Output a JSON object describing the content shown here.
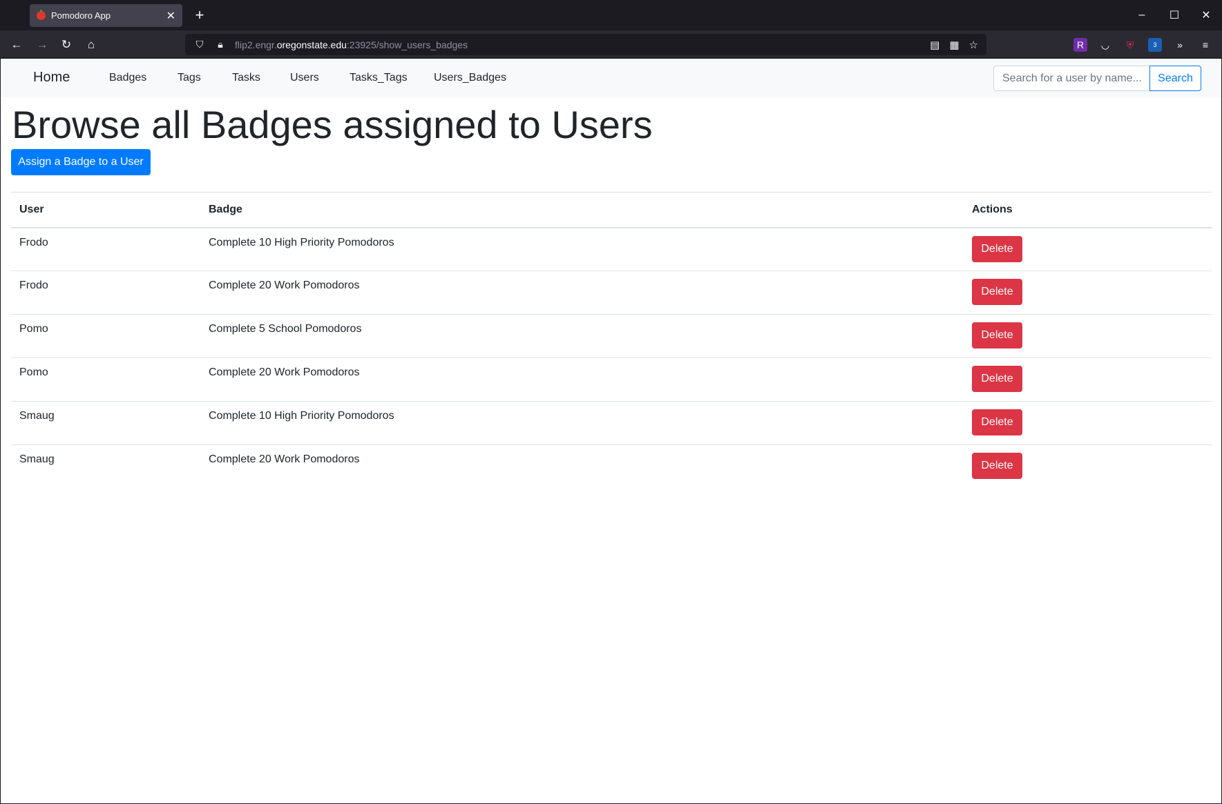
{
  "browser": {
    "tab_title": "Pomodoro App",
    "url_prefix": "flip2.engr.",
    "url_domain": "oregonstate.edu",
    "url_suffix": ":23925/show_users_badges",
    "extension_badge_count": "3"
  },
  "site": {
    "brand": "Home",
    "nav_links": [
      "Badges",
      "Tags",
      "Tasks",
      "Users",
      "Tasks_Tags",
      "Users_Badges"
    ],
    "search_placeholder": "Search for a user by name...",
    "search_label": "Search"
  },
  "page": {
    "title": "Browse all Badges assigned to Users",
    "assign_button": "Assign a Badge to a User"
  },
  "table": {
    "headers": [
      "User",
      "Badge",
      "Actions"
    ],
    "delete_label": "Delete",
    "rows": [
      {
        "user": "Frodo",
        "badge": "Complete 10 High Priority Pomodoros"
      },
      {
        "user": "Frodo",
        "badge": "Complete 20 Work Pomodoros"
      },
      {
        "user": "Pomo",
        "badge": "Complete 5 School Pomodoros"
      },
      {
        "user": "Pomo",
        "badge": "Complete 20 Work Pomodoros"
      },
      {
        "user": "Smaug",
        "badge": "Complete 10 High Priority Pomodoros"
      },
      {
        "user": "Smaug",
        "badge": "Complete 20 Work Pomodoros"
      }
    ]
  },
  "colors": {
    "primary": "#007bff",
    "danger": "#dc3545",
    "browser_dark": "#1c1b22"
  }
}
